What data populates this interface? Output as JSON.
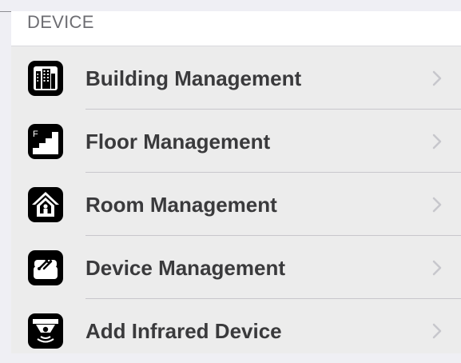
{
  "section": {
    "header": "DEVICE"
  },
  "items": [
    {
      "label": "Building Management",
      "icon": "building-icon"
    },
    {
      "label": "Floor Management",
      "icon": "floor-stairs-icon"
    },
    {
      "label": "Room Management",
      "icon": "house-icon"
    },
    {
      "label": "Device Management",
      "icon": "device-tools-icon"
    },
    {
      "label": "Add Infrared Device",
      "icon": "infrared-sensor-icon"
    }
  ],
  "colors": {
    "background": "#efeff4",
    "row_background": "#ececec",
    "label": "#3a3a3c",
    "header": "#6d6d72",
    "chevron": "#c7c7cc",
    "icon": "#000000"
  }
}
